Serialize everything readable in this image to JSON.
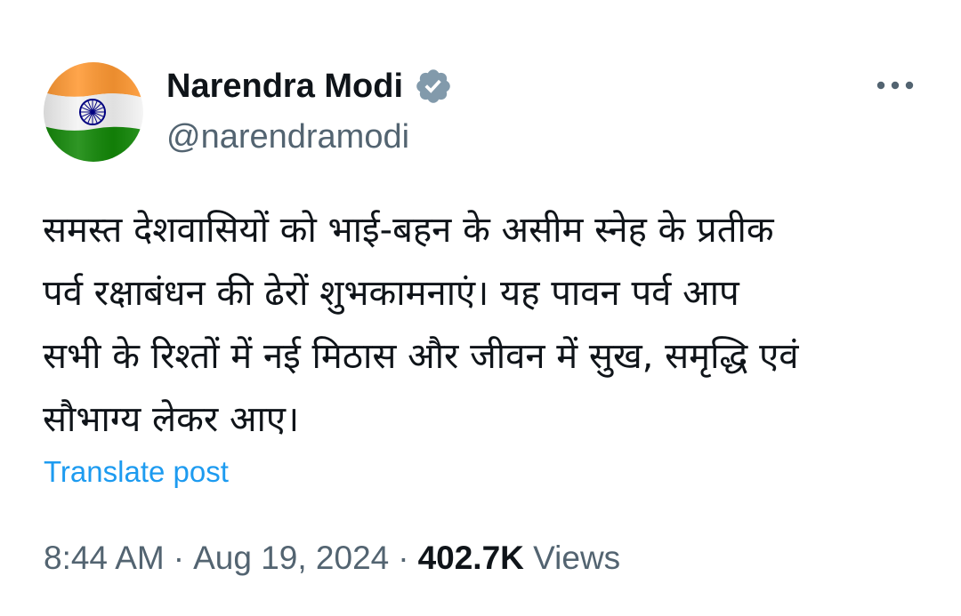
{
  "author": {
    "display_name": "Narendra Modi",
    "handle": "@narendramodi",
    "verified": true,
    "verified_icon": "verified-badge-icon",
    "avatar": "india-flag-avatar"
  },
  "more_icon": "more-horizontal-icon",
  "post": {
    "lines": [
      "समस्त देशवासियों को भाई-बहन के असीम स्नेह के प्रतीक",
      "पर्व रक्षाबंधन की ढेरों शुभकामनाएं। यह पावन पर्व आप",
      "सभी के रिश्तों में नई मिठास और जीवन में सुख, समृद्धि एवं",
      "सौभाग्य लेकर आए।"
    ]
  },
  "translate_label": "Translate post",
  "meta": {
    "time": "8:44 AM",
    "separator": "·",
    "date": "Aug 19, 2024",
    "views_count": "402.7K",
    "views_label": "Views"
  },
  "colors": {
    "text": "#0f1419",
    "secondary": "#536471",
    "link": "#1d9bf0",
    "verified_badge": "#829aab",
    "saffron": "#ff9933",
    "green": "#138808",
    "chakra": "#000080"
  }
}
